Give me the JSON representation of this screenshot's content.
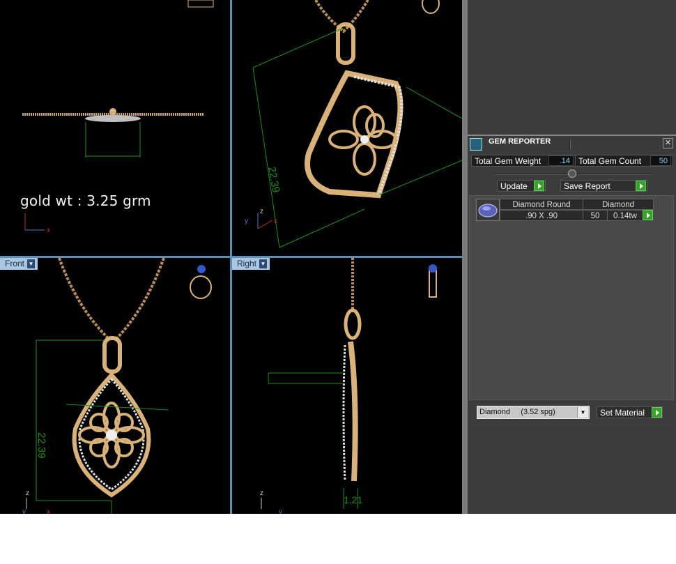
{
  "viewports": {
    "top_left": {
      "label": "",
      "annotation": "gold wt : 3.25 grm"
    },
    "top_right": {
      "label": "",
      "dimension": "22.39"
    },
    "bottom_left": {
      "label": "Front",
      "dimension": "22.39"
    },
    "bottom_right": {
      "label": "Right",
      "dimension": "1.21"
    },
    "axes": {
      "z": "z",
      "x": "x",
      "y": "y"
    }
  },
  "gem_reporter": {
    "title": "GEM REPORTER",
    "close_label": "✕",
    "total_weight_label": "Total Gem Weight",
    "total_weight_value": ".14",
    "total_count_label": "Total Gem Count",
    "total_count_value": "50",
    "update_label": "Update",
    "save_report_label": "Save Report",
    "gem": {
      "shape": "Diamond Round",
      "size": ".90 X .90",
      "material": "Diamond",
      "count": "50",
      "weight": "0.14tw"
    },
    "material_select": "Diamond     (3.52 spg)",
    "set_material_label": "Set Material"
  },
  "colors": {
    "gold": "#d9b27a",
    "diamond": "#e8e8e8",
    "dimension": "#1f8f1f",
    "panel": "#3c3c3c"
  }
}
